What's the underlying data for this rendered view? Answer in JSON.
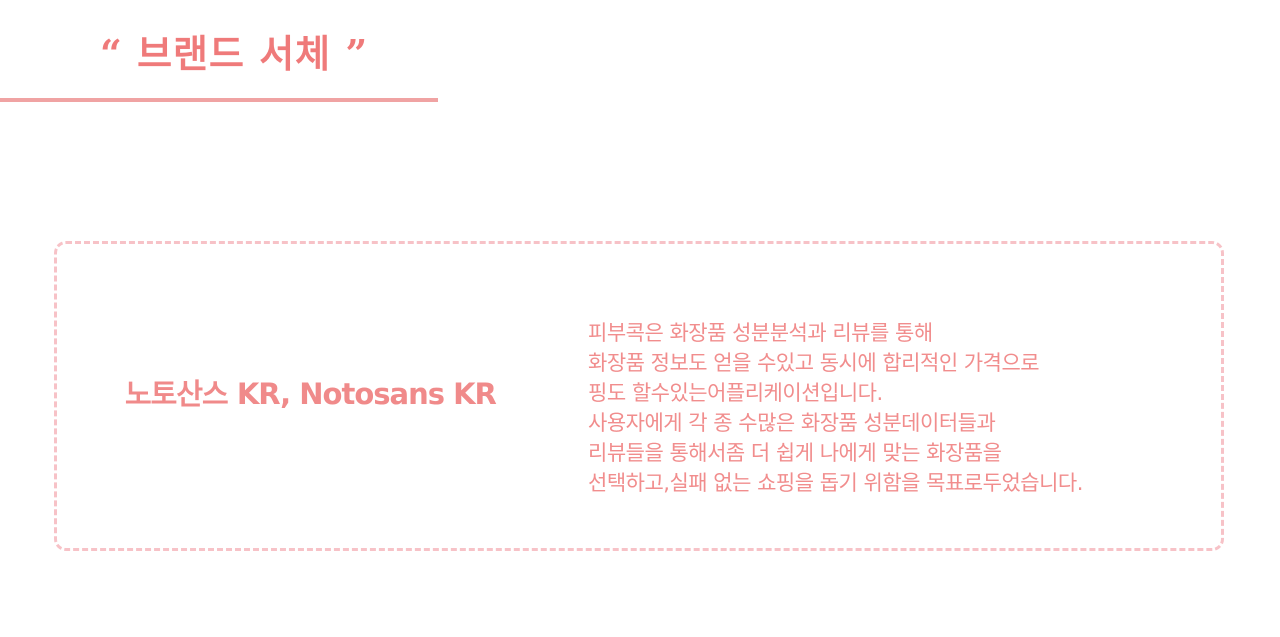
{
  "header": {
    "title": "“ 브랜드 서체 ”"
  },
  "font_card": {
    "font_name": "노토산스 KR, Notosans KR",
    "sample_lines": [
      "피부콕은 화장품 성분분석과 리뷰를 통해",
      "화장품 정보도 얻을 수있고 동시에 합리적인 가격으로",
      "핑도 할수있는어플리케이션입니다.",
      "사용자에게 각 종 수많은 화장품 성분데이터들과",
      "리뷰들을 통해서좀 더 쉽게 나에게 맞는 화장품을",
      "선택하고,실패 없는 쇼핑을 돕기 위함을 목표로두었습니다."
    ]
  },
  "colors": {
    "accent": "#ef7a7a",
    "underline": "#f0a3a3",
    "card_border": "#f7c2c7",
    "text": "#f18d8d",
    "background": "#ffffff"
  }
}
